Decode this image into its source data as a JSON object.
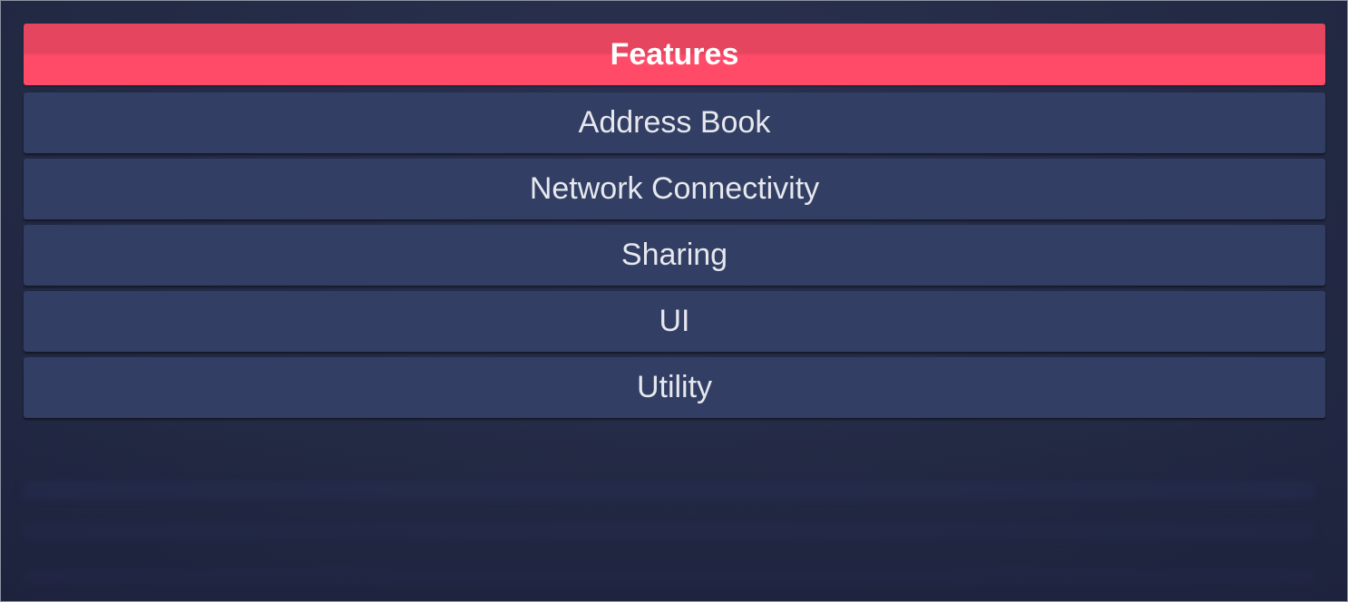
{
  "header": {
    "title": "Features"
  },
  "items": [
    {
      "label": "Address Book"
    },
    {
      "label": "Network Connectivity"
    },
    {
      "label": "Sharing"
    },
    {
      "label": "UI"
    },
    {
      "label": "Utility"
    }
  ],
  "colors": {
    "header": "#ff4a68",
    "item": "#323e63",
    "background": "#232a44"
  }
}
